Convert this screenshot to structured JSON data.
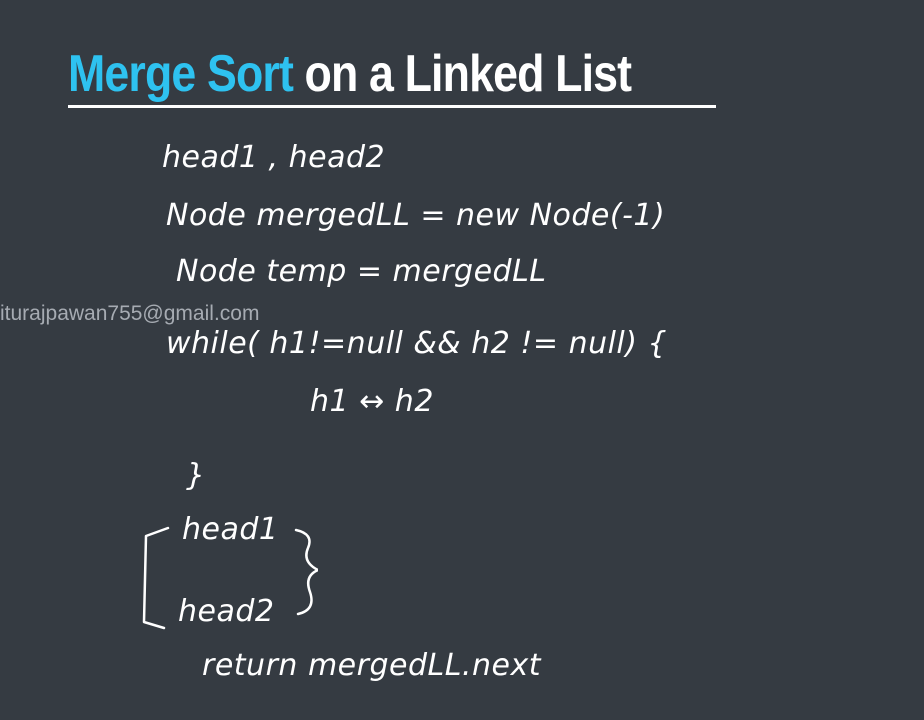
{
  "slide": {
    "title_accent": "Merge Sort",
    "title_rest": " on a Linked List",
    "watermark": "iturajpawan755@gmail.com",
    "notes": {
      "line1": "head1 , head2",
      "line2": "Node   mergedLL  = new Node(-1)",
      "line3": "Node temp  = mergedLL",
      "line4": "while( h1!=null  && h2 != null) {",
      "line5": "h1 ↔ h2",
      "line6": "}",
      "line7": "head1",
      "line8": "head2",
      "line9": "return  mergedLL.next"
    }
  },
  "colors": {
    "background": "#353b42",
    "accent": "#2ec2f0",
    "ink": "#ffffff",
    "watermark": "#a6abb2"
  }
}
